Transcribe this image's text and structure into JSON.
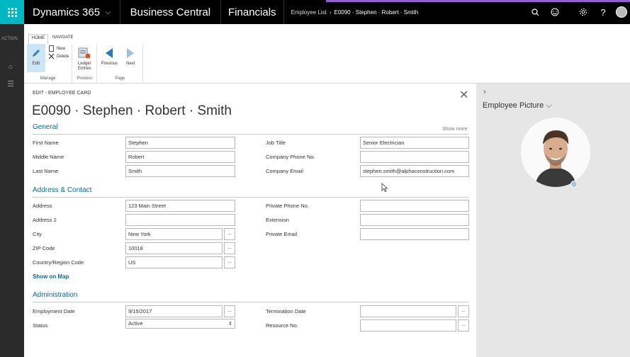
{
  "topbar": {
    "brand": "Dynamics 365",
    "product": "Business Central",
    "module": "Financials",
    "breadcrumb": [
      "Employee List",
      "E0090 · Stephen · Robert · Smith"
    ]
  },
  "rail": {
    "label": "ACTION"
  },
  "ribbon": {
    "tabs": [
      "HOME",
      "NAVIGATE"
    ],
    "groups": [
      {
        "label": "Manage",
        "buttons": [
          "Edit",
          "New",
          "Delete"
        ]
      },
      {
        "label": "Process",
        "buttons": [
          "Ledger Entries"
        ]
      },
      {
        "label": "Page",
        "buttons": [
          "Previous",
          "Next"
        ]
      }
    ]
  },
  "card": {
    "caption": "EDIT - EMPLOYEE CARD",
    "title": "E0090 · Stephen · Robert · Smith",
    "general": {
      "heading": "General",
      "show_more": "Show more",
      "first_name_label": "First Name",
      "first_name": "Stephen",
      "middle_name_label": "Middle Name",
      "middle_name": "Robert",
      "last_name_label": "Last Name",
      "last_name": "Smith",
      "job_title_label": "Job Title",
      "job_title": "Senior Electrician",
      "company_phone_label": "Company Phone No.",
      "company_phone": "",
      "company_email_label": "Company Email",
      "company_email": "stephen.smith@alphaconstruction.com"
    },
    "address": {
      "heading": "Address & Contact",
      "address_label": "Address",
      "address": "123 Main Street",
      "address2_label": "Address 2",
      "address2": "",
      "city_label": "City",
      "city": "New York",
      "zip_label": "ZIP Code",
      "zip": "10018",
      "country_label": "Country/Region Code",
      "country": "US",
      "show_on_map": "Show on Map",
      "private_phone_label": "Private Phone No.",
      "private_phone": "",
      "extension_label": "Extension",
      "extension": "",
      "private_email_label": "Private Email",
      "private_email": ""
    },
    "admin": {
      "heading": "Administration",
      "employment_date_label": "Employment Date",
      "employment_date": "9/15/2017",
      "status_label": "Status",
      "status": "Active",
      "termination_date_label": "Termination Date",
      "termination_date": "",
      "resource_no_label": "Resource No.",
      "resource_no": ""
    },
    "lookup_label": "..."
  },
  "right_panel": {
    "title": "Employee Picture"
  }
}
